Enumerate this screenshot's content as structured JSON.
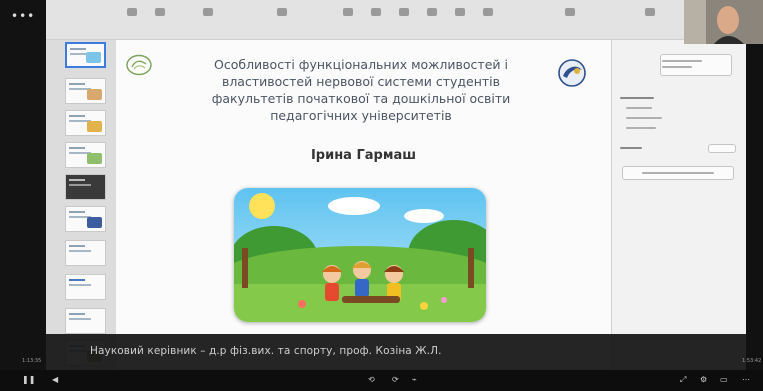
{
  "slide": {
    "title_lines": [
      "Особливості функціональних можливостей і",
      "властивостей нервової системи студентів",
      "факультетів початкової та дошкільної освіти",
      "педагогічних університетів"
    ],
    "author": "Ірина Гармаш",
    "image_icon": "children-playing-illustration"
  },
  "caption": {
    "text": "Науковий керівник – д.р фіз.вих. та спорту, проф. Козіна Ж.Л."
  },
  "bottom_bar": {
    "left_time": "1:13:35",
    "right_time": "1:53:42"
  },
  "colors": {
    "title_text": "#4b5563",
    "active_thumb": "#3c7be0",
    "caption_bar": "#121212"
  }
}
